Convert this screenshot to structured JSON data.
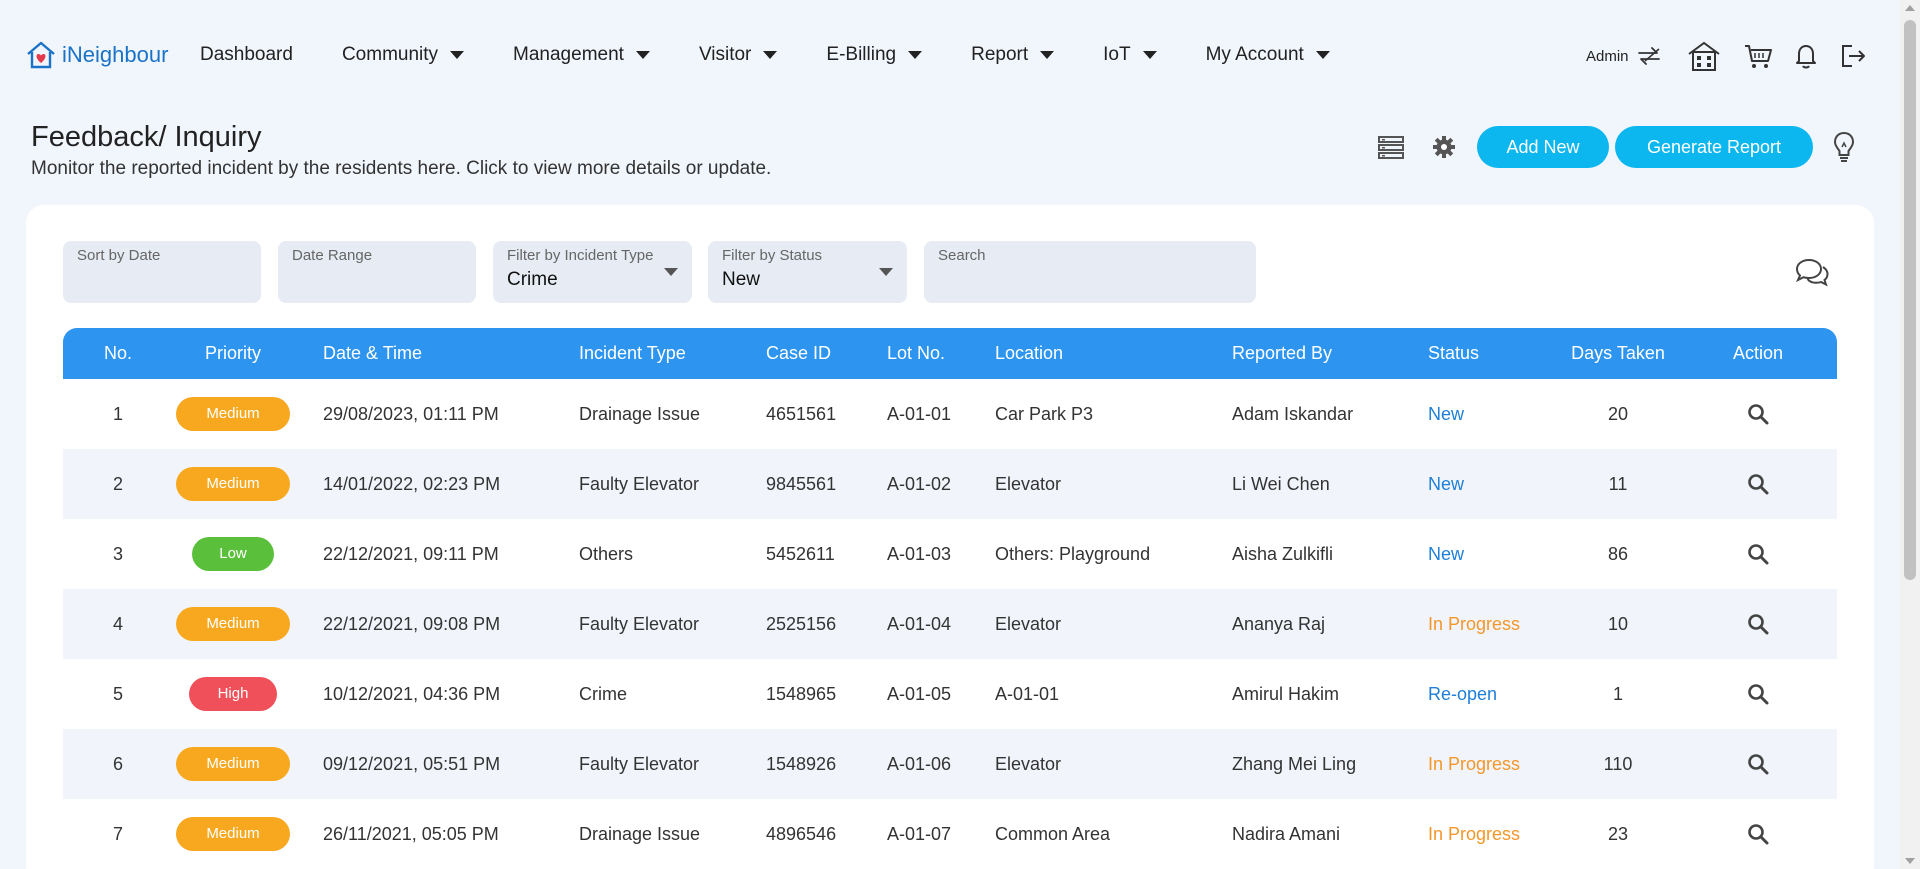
{
  "app": {
    "logo_text": "iNeighbour"
  },
  "nav": {
    "items": [
      {
        "label": "Dashboard",
        "dropdown": false
      },
      {
        "label": "Community",
        "dropdown": true
      },
      {
        "label": "Management",
        "dropdown": true
      },
      {
        "label": "Visitor",
        "dropdown": true
      },
      {
        "label": "E-Billing",
        "dropdown": true
      },
      {
        "label": "Report",
        "dropdown": true
      },
      {
        "label": "IoT",
        "dropdown": true
      },
      {
        "label": "My Account",
        "dropdown": true
      }
    ],
    "admin_label": "Admin",
    "icons": [
      "switch-user-icon",
      "building-icon",
      "cart-icon",
      "bell-icon",
      "logout-icon"
    ]
  },
  "header": {
    "title": "Feedback/ Inquiry",
    "subtitle": "Monitor the reported incident by the residents here. Click to view more details or update.",
    "add_new_label": "Add New",
    "generate_report_label": "Generate Report",
    "icons": [
      "list-view-icon",
      "settings-gear-icon",
      "lightbulb-icon"
    ]
  },
  "filters": {
    "sort_by_date": {
      "label": "Sort by Date",
      "value": ""
    },
    "date_range": {
      "label": "Date Range",
      "value": ""
    },
    "incident_type": {
      "label": "Filter by Incident Type",
      "value": "Crime"
    },
    "status": {
      "label": "Filter by Status",
      "value": "New"
    },
    "search": {
      "label": "Search",
      "value": ""
    }
  },
  "table": {
    "columns": [
      "No.",
      "Priority",
      "Date & Time",
      "Incident Type",
      "Case ID",
      "Lot No.",
      "Location",
      "Reported By",
      "Status",
      "Days Taken",
      "Action"
    ],
    "rows": [
      {
        "no": "1",
        "priority": "Medium",
        "datetime": "29/08/2023, 01:11 PM",
        "type": "Drainage Issue",
        "case_id": "4651561",
        "lot": "A-01-01",
        "location": "Car Park P3",
        "reported_by": "Adam Iskandar",
        "status": "New",
        "days": "20"
      },
      {
        "no": "2",
        "priority": "Medium",
        "datetime": "14/01/2022, 02:23 PM",
        "type": "Faulty Elevator",
        "case_id": "9845561",
        "lot": "A-01-02",
        "location": "Elevator",
        "reported_by": "Li Wei Chen",
        "status": "New",
        "days": "11"
      },
      {
        "no": "3",
        "priority": "Low",
        "datetime": "22/12/2021, 09:11 PM",
        "type": "Others",
        "case_id": "5452611",
        "lot": "A-01-03",
        "location": "Others: Playground",
        "reported_by": "Aisha Zulkifli",
        "status": "New",
        "days": "86"
      },
      {
        "no": "4",
        "priority": "Medium",
        "datetime": "22/12/2021, 09:08 PM",
        "type": "Faulty Elevator",
        "case_id": "2525156",
        "lot": "A-01-04",
        "location": "Elevator",
        "reported_by": "Ananya Raj",
        "status": "In Progress",
        "days": "10"
      },
      {
        "no": "5",
        "priority": "High",
        "datetime": "10/12/2021, 04:36 PM",
        "type": "Crime",
        "case_id": "1548965",
        "lot": "A-01-05",
        "location": "A-01-01",
        "reported_by": "Amirul Hakim",
        "status": "Re-open",
        "days": "1"
      },
      {
        "no": "6",
        "priority": "Medium",
        "datetime": "09/12/2021, 05:51 PM",
        "type": "Faulty Elevator",
        "case_id": "1548926",
        "lot": "A-01-06",
        "location": "Elevator",
        "reported_by": "Zhang Mei Ling",
        "status": "In Progress",
        "days": "110"
      },
      {
        "no": "7",
        "priority": "Medium",
        "datetime": "26/11/2021, 05:05 PM",
        "type": "Drainage Issue",
        "case_id": "4896546",
        "lot": "A-01-07",
        "location": "Common Area",
        "reported_by": "Nadira Amani",
        "status": "In Progress",
        "days": "23"
      }
    ]
  },
  "colors": {
    "accent": "#0cb6ee",
    "table_header": "#2d95f0",
    "priority_medium": "#f7a81e",
    "priority_low": "#5ac03c",
    "priority_high": "#f0505a",
    "status_new": "#1f7fd8",
    "status_in_progress": "#f3972a",
    "status_reopen": "#1f7fd8"
  }
}
